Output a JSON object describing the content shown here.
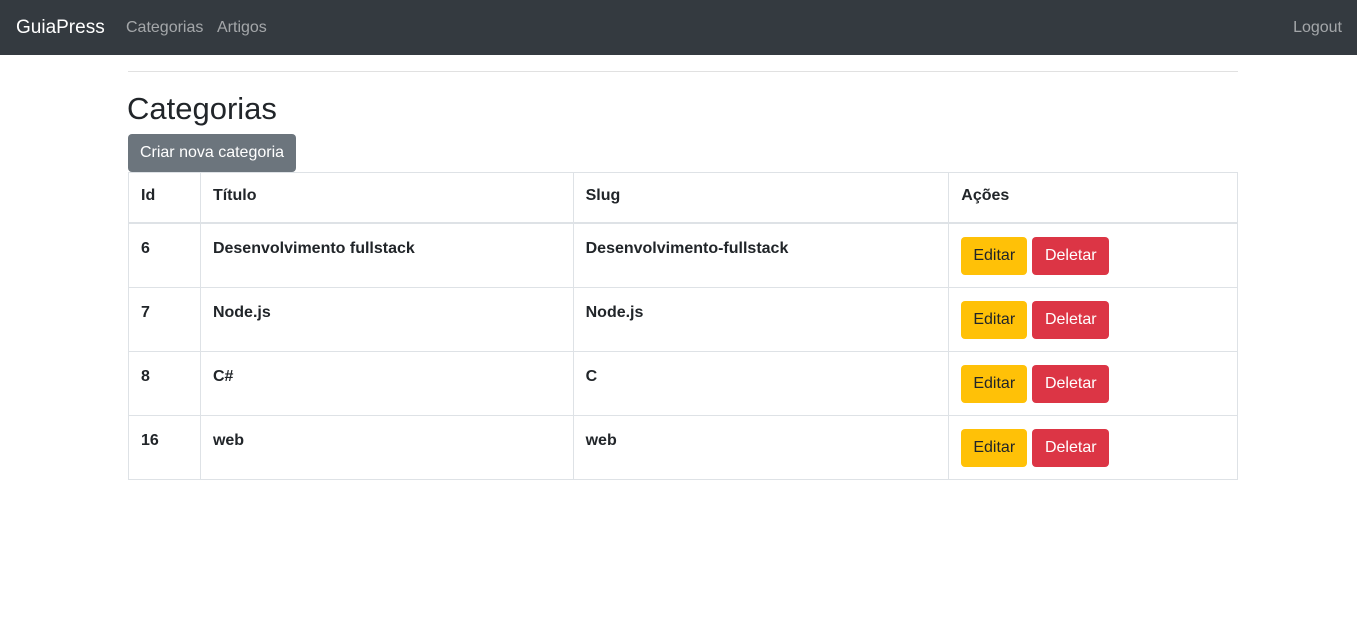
{
  "navbar": {
    "brand": "GuiaPress",
    "links": [
      {
        "label": "Categorias"
      },
      {
        "label": "Artigos"
      }
    ],
    "logout": "Logout"
  },
  "page": {
    "title": "Categorias",
    "create_button": "Criar nova categoria"
  },
  "table": {
    "headers": [
      "Id",
      "Título",
      "Slug",
      "Ações"
    ],
    "rows": [
      {
        "id": "6",
        "title": "Desenvolvimento fullstack",
        "slug": "Desenvolvimento-fullstack"
      },
      {
        "id": "7",
        "title": "Node.js",
        "slug": "Node.js"
      },
      {
        "id": "8",
        "title": "C#",
        "slug": "C"
      },
      {
        "id": "16",
        "title": "web",
        "slug": "web"
      }
    ],
    "edit_label": "Editar",
    "delete_label": "Deletar"
  },
  "colors": {
    "navbar": "#343a40",
    "secondary": "#6c757d",
    "warning": "#ffc107",
    "danger": "#dc3545"
  }
}
